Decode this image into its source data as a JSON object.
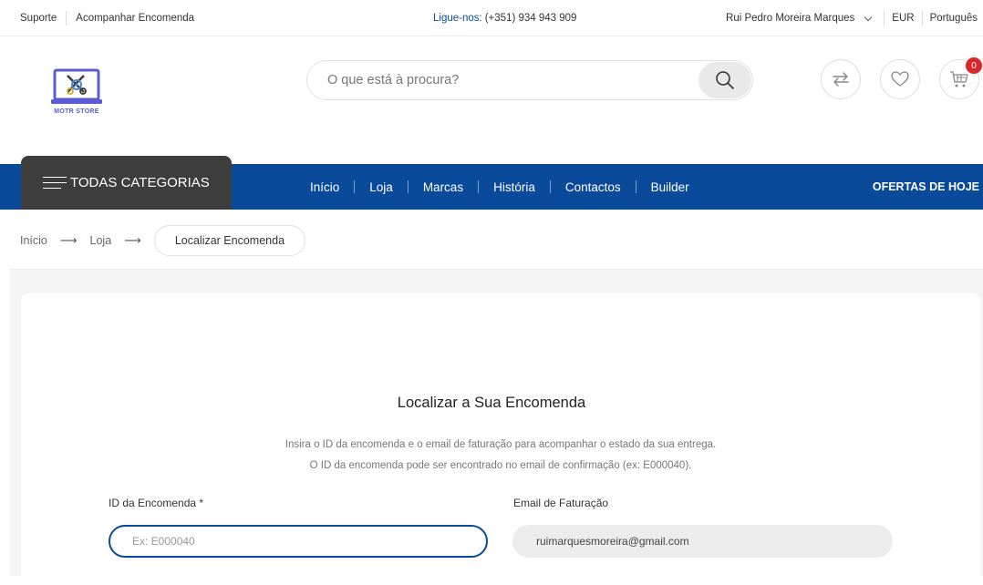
{
  "topbar": {
    "support": "Suporte",
    "track_order": "Acompanhar Encomenda",
    "phone_label": "Ligue-nos:",
    "phone_number": "(+351) 934 943 909",
    "user_name": "Rui Pedro Moreira Marques",
    "currency": "EUR",
    "language": "Português"
  },
  "header": {
    "logo_text": "MOTR STORE",
    "search_placeholder": "O que está à procura?",
    "cart_count": "0"
  },
  "nav": {
    "all_categories": "TODAS CATEGORIAS",
    "links": [
      "Início",
      "Loja",
      "Marcas",
      "História",
      "Contactos",
      "Builder"
    ],
    "offers": "OFERTAS DE HOJE"
  },
  "breadcrumb": {
    "items": [
      "Início",
      "Loja"
    ],
    "current": "Localizar Encomenda"
  },
  "form": {
    "title": "Localizar a Sua Encomenda",
    "info_line1": "Insira o ID da encomenda e o email de faturação para acompanhar o estado da sua entrega.",
    "info_line2": "O ID da encomenda pode ser encontrado no email de confirmação (ex: E000040).",
    "order_id_label": "ID da Encomenda *",
    "order_id_placeholder": "Ex: E000040",
    "email_label": "Email de Faturação",
    "email_value": "ruimarquesmoreira@gmail.com"
  },
  "colors": {
    "brand_blue": "#0a4a9a",
    "category_dark": "#3d3d3d",
    "badge_red": "#d9262c"
  }
}
